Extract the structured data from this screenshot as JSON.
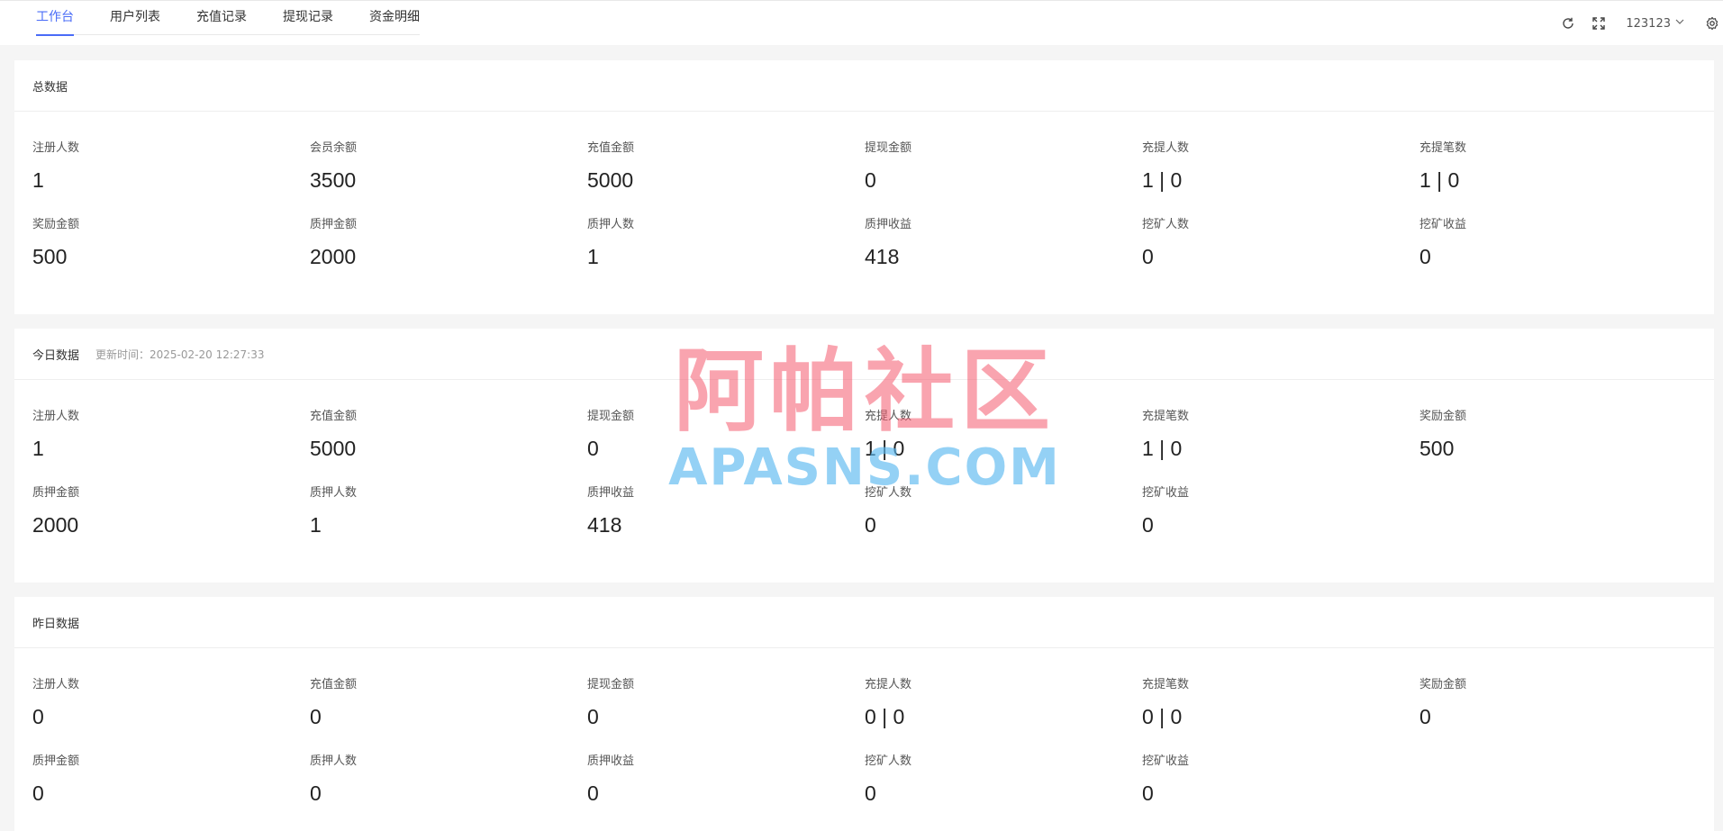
{
  "nav": {
    "tabs": [
      "工作台",
      "用户列表",
      "充值记录",
      "提现记录",
      "资金明细"
    ],
    "active_index": 0,
    "username": "123123"
  },
  "sections": [
    {
      "title": "总数据",
      "subtitle": "",
      "stats": [
        {
          "label": "注册人数",
          "value": "1"
        },
        {
          "label": "会员余额",
          "value": "3500"
        },
        {
          "label": "充值金额",
          "value": "5000"
        },
        {
          "label": "提现金额",
          "value": "0"
        },
        {
          "label": "充提人数",
          "value": "1 | 0"
        },
        {
          "label": "充提笔数",
          "value": "1 | 0"
        },
        {
          "label": "奖励金额",
          "value": "500"
        },
        {
          "label": "质押金额",
          "value": "2000"
        },
        {
          "label": "质押人数",
          "value": "1"
        },
        {
          "label": "质押收益",
          "value": "418"
        },
        {
          "label": "挖矿人数",
          "value": "0"
        },
        {
          "label": "挖矿收益",
          "value": "0"
        }
      ]
    },
    {
      "title": "今日数据",
      "subtitle": "更新时间：2025-02-20 12:27:33",
      "stats": [
        {
          "label": "注册人数",
          "value": "1"
        },
        {
          "label": "充值金额",
          "value": "5000"
        },
        {
          "label": "提现金额",
          "value": "0"
        },
        {
          "label": "充提人数",
          "value": "1 | 0"
        },
        {
          "label": "充提笔数",
          "value": "1 | 0"
        },
        {
          "label": "奖励金额",
          "value": "500"
        },
        {
          "label": "质押金额",
          "value": "2000"
        },
        {
          "label": "质押人数",
          "value": "1"
        },
        {
          "label": "质押收益",
          "value": "418"
        },
        {
          "label": "挖矿人数",
          "value": "0"
        },
        {
          "label": "挖矿收益",
          "value": "0"
        }
      ]
    },
    {
      "title": "昨日数据",
      "subtitle": "",
      "stats": [
        {
          "label": "注册人数",
          "value": "0"
        },
        {
          "label": "充值金额",
          "value": "0"
        },
        {
          "label": "提现金额",
          "value": "0"
        },
        {
          "label": "充提人数",
          "value": "0 | 0"
        },
        {
          "label": "充提笔数",
          "value": "0 | 0"
        },
        {
          "label": "奖励金额",
          "value": "0"
        },
        {
          "label": "质押金额",
          "value": "0"
        },
        {
          "label": "质押人数",
          "value": "0"
        },
        {
          "label": "质押收益",
          "value": "0"
        },
        {
          "label": "挖矿人数",
          "value": "0"
        },
        {
          "label": "挖矿收益",
          "value": "0"
        }
      ]
    }
  ],
  "watermark": {
    "cn": "阿帕社区",
    "en": "APASNS.COM"
  },
  "icons": {
    "refresh": "refresh-icon",
    "fullscreen": "fullscreen-icon",
    "dropdown": "chevron-down-icon",
    "settings": "gear-icon"
  },
  "colors": {
    "accent": "#4a6cf7",
    "background": "#f5f5f5"
  }
}
